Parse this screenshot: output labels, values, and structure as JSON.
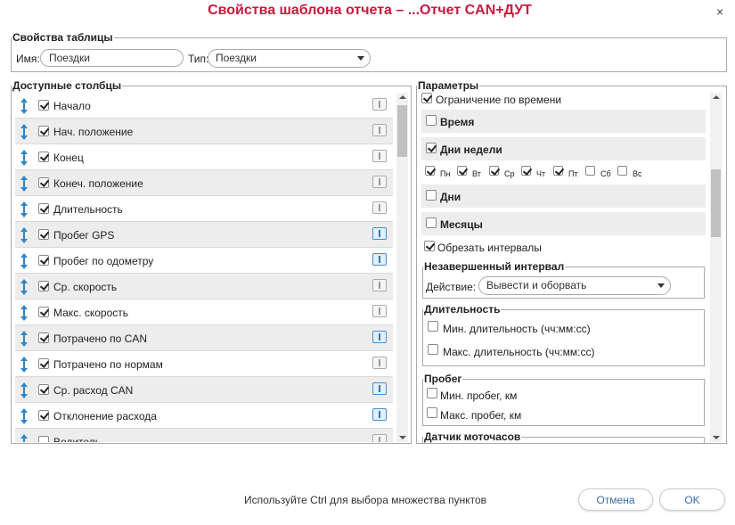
{
  "dialog": {
    "title": "Свойства шаблона отчета – ...Отчет CAN+ДУТ",
    "close_label": "×"
  },
  "table_props": {
    "legend": "Свойства таблицы",
    "name_label": "Имя:",
    "name_value": "Поездки",
    "type_label": "Тип:",
    "type_value": "Поездки"
  },
  "columns": {
    "legend": "Доступные столбцы",
    "items": [
      {
        "label": "Начало",
        "checked": true,
        "active": false
      },
      {
        "label": "Нач. положение",
        "checked": true,
        "active": false
      },
      {
        "label": "Конец",
        "checked": true,
        "active": false
      },
      {
        "label": "Конеч. положение",
        "checked": true,
        "active": false
      },
      {
        "label": "Длительность",
        "checked": true,
        "active": false
      },
      {
        "label": "Пробег GPS",
        "checked": true,
        "active": true
      },
      {
        "label": "Пробег по одометру",
        "checked": true,
        "active": true
      },
      {
        "label": "Ср. скорость",
        "checked": true,
        "active": false
      },
      {
        "label": "Макс. скорость",
        "checked": true,
        "active": false
      },
      {
        "label": "Потрачено по CAN",
        "checked": true,
        "active": true
      },
      {
        "label": "Потрачено по нормам",
        "checked": true,
        "active": false
      },
      {
        "label": "Ср. расход CAN",
        "checked": true,
        "active": true
      },
      {
        "label": "Отклонение расхода",
        "checked": true,
        "active": true
      },
      {
        "label": "Водитель",
        "checked": false,
        "active": false
      }
    ]
  },
  "params": {
    "legend": "Параметры",
    "time_limit": "Ограничение по времени",
    "time": "Время",
    "weekdays": "Дни недели",
    "days": [
      {
        "label": "Пн",
        "checked": true
      },
      {
        "label": "Вт",
        "checked": true
      },
      {
        "label": "Ср",
        "checked": true
      },
      {
        "label": "Чт",
        "checked": true
      },
      {
        "label": "Пт",
        "checked": true
      },
      {
        "label": "Сб",
        "checked": false
      },
      {
        "label": "Вс",
        "checked": false
      }
    ],
    "month_days": "Дни",
    "months": "Месяцы",
    "cut_intervals": "Обрезать интервалы",
    "unfinished": {
      "legend": "Незавершенный интервал",
      "action_label": "Действие:",
      "action_value": "Вывести и оборвать"
    },
    "duration": {
      "legend": "Длительность",
      "min": "Мин. длительность (чч:мм:сс)",
      "max": "Макс. длительность (чч:мм:сс)"
    },
    "mileage": {
      "legend": "Пробег",
      "min": "Мин. пробег, км",
      "max": "Макс. пробег, км"
    },
    "engine_hours": {
      "legend": "Датчик моточасов"
    }
  },
  "footer": {
    "hint": "Используйте Ctrl для выбора множества пунктов",
    "cancel": "Отмена",
    "ok": "OK"
  }
}
